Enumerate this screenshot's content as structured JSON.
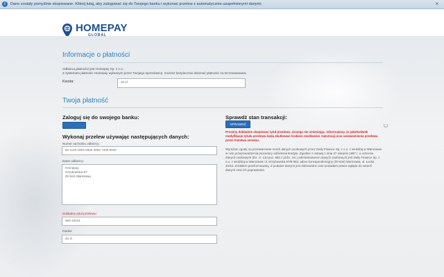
{
  "notice": {
    "text": "Dane zostały pomyślnie skopiowane. Kliknij tutaj, aby zalogować się do Twojego banku i wykonać przelew z automatycznie uzupełnionymi danymi.",
    "close": "×"
  },
  "logo": {
    "main": "HOMEPAY",
    "sub": "GLOBAL"
  },
  "payment_info": {
    "title": "Informacje o płatności",
    "recipient_line": "Odbiorcą płatności jest Homepay Sp. z o.o.",
    "description_line": "Z systemem płatności Homepay wybranym przez Twojego sprzedawcę, możesz bezpiecznie dokonać płatności za teczowwwwww.",
    "amount_label": "Kwota:",
    "amount_value": "20 zł"
  },
  "your_payment": {
    "title": "Twoja płatność",
    "login_heading": "Zaloguj się do swojego banku:",
    "login_button": "",
    "transfer_heading": "Wykonaj przelew używając następujących danych:",
    "account_label": "Numer rachunku odbiorcy:",
    "account_value": "94 1140 2004 0000 3002 7339 8043",
    "recipient_label": "Dane odbiorcy:",
    "recipient_lines": [
      "Homepay",
      "Grzybowska 87",
      "00-844 Warszawa"
    ],
    "title_label": "Dokładny tytuł przelewu:",
    "title_value": "WD-19101",
    "amount_label": "Kwota:",
    "amount_value": "20 zł"
  },
  "status": {
    "heading": "Sprawdź stan transakcji:",
    "check_button": "SPRAWDŹ",
    "warning": "Prosimy dokładnie skopiować tytuł przelewu, niczego nie zmieniając. Informujemy, że jakiekolwiek modyfikacje tytułu przelewu będą skutkować brakiem możliwości rejestracji oraz unieważnienia przelewu przez Państwa serwisu.",
    "privacy": "Wyrażam zgodę na przetwarzanie moich danych osobowych przez Daily Finance Sp. z o.o. z siedzibą w Warszawie w celu przeprowadzenia procedury udzielenia kredytu. Zgodnie z ustawą z dnia 27 sierpnia 1997 r. o ochronie danych osobowych (Dz. U. 133 poz. 883 z późn. zm.) administratorem danych osobowych jest Daily Finance Sp. z o.o. z siedzibą w Warszawie ul. Grzybowska 87/B 883, adres korespondencyjny (00-844) Warszawa, ul. Łucka 20/43. Zostałem poinformowany, iż podanie danych jest dobrowolne oraz posiadam prawo wglądu do swoich danych oraz ich poprawiania."
  }
}
